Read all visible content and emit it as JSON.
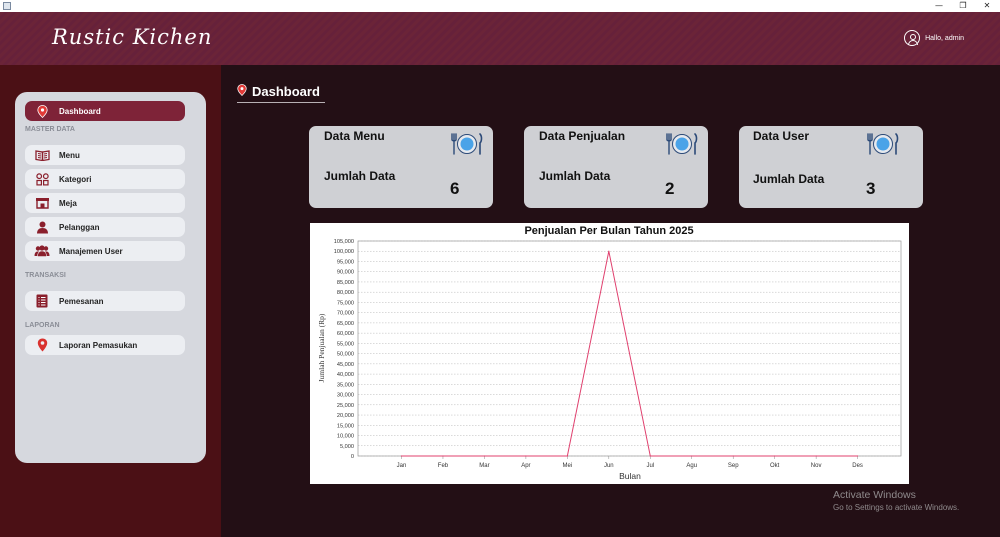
{
  "window": {
    "minimize": "—",
    "restore": "❐",
    "close": "✕"
  },
  "header": {
    "app_title": "Rustic Kichen",
    "greeting": "Hallo, admin"
  },
  "sidebar": {
    "dashboard": "Dashboard",
    "section_master": "MASTER DATA",
    "menu": "Menu",
    "kategori": "Kategori",
    "meja": "Meja",
    "pelanggan": "Pelanggan",
    "manajemen_user": "Manajemen User",
    "section_transaksi": "TRANSAKSI",
    "pemesanan": "Pemesanan",
    "section_laporan": "LAPORAN",
    "laporan_pemasukan": "Laporan Pemasukan"
  },
  "page": {
    "title": "Dashboard"
  },
  "cards": [
    {
      "title": "Data Menu",
      "label": "Jumlah Data",
      "value": "6"
    },
    {
      "title": "Data Penjualan",
      "label": "Jumlah Data",
      "value": "2"
    },
    {
      "title": "Data User",
      "label": "Jumlah Data",
      "value": "3"
    }
  ],
  "colors": {
    "header": "#6b2438",
    "active_nav": "#7e2338",
    "accent_red": "#d9322f",
    "chart_line": "#e0406e"
  },
  "chart_data": {
    "type": "line",
    "title": "Penjualan Per Bulan Tahun 2025",
    "xlabel": "Bulan",
    "ylabel": "Jumlah Penjualan (Rp)",
    "categories": [
      "Jan",
      "Feb",
      "Mar",
      "Apr",
      "Mei",
      "Jun",
      "Jul",
      "Agu",
      "Sep",
      "Okt",
      "Nov",
      "Des"
    ],
    "series": [
      {
        "values": [
          0,
          0,
          0,
          0,
          0,
          100000,
          0,
          0,
          0,
          0,
          0,
          0
        ]
      }
    ],
    "ylim": [
      0,
      105000
    ],
    "yticks": [
      "0",
      "5,000",
      "10,000",
      "15,000",
      "20,000",
      "25,000",
      "30,000",
      "35,000",
      "40,000",
      "45,000",
      "50,000",
      "55,000",
      "60,000",
      "65,000",
      "70,000",
      "75,000",
      "80,000",
      "85,000",
      "90,000",
      "95,000",
      "100,000",
      "105,000"
    ],
    "grid": true,
    "legend": "none"
  },
  "watermark": {
    "line1": "Activate Windows",
    "line2": "Go to Settings to activate Windows."
  }
}
